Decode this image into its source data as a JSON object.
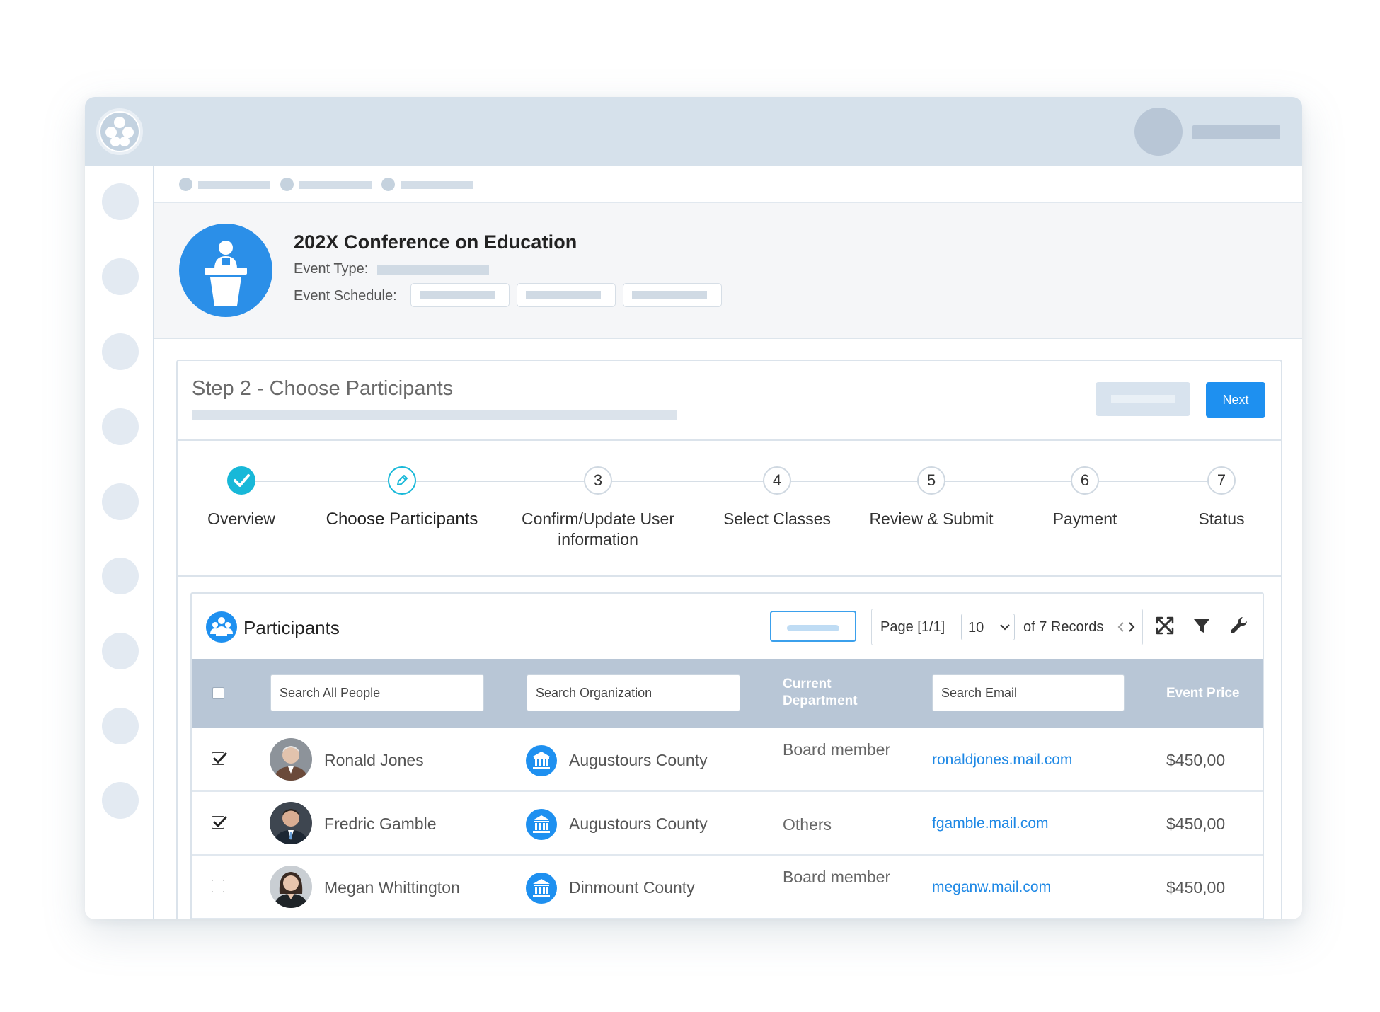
{
  "event": {
    "title": "202X Conference on Education",
    "type_label": "Event Type:",
    "schedule_label": "Event Schedule:"
  },
  "step": {
    "title": "Step 2 - Choose Participants",
    "next_label": "Next"
  },
  "stepper": [
    {
      "number": "",
      "label": "Overview",
      "state": "done"
    },
    {
      "number": "",
      "label": "Choose Participants",
      "state": "current"
    },
    {
      "number": "3",
      "label": "Confirm/Update User information",
      "state": "pending"
    },
    {
      "number": "4",
      "label": "Select Classes",
      "state": "pending"
    },
    {
      "number": "5",
      "label": "Review & Submit",
      "state": "pending"
    },
    {
      "number": "6",
      "label": "Payment",
      "state": "pending"
    },
    {
      "number": "7",
      "label": "Status",
      "state": "pending"
    }
  ],
  "panel": {
    "title": "Participants",
    "pager": {
      "page_text": "Page [1/1]",
      "page_size": "10",
      "records_text": "of 7 Records"
    }
  },
  "table": {
    "search_people_placeholder": "Search All People",
    "search_org_placeholder": "Search Organization",
    "dept_header": "Current Department",
    "search_email_placeholder": "Search Email",
    "price_header": "Event Price",
    "rows": [
      {
        "checked": true,
        "name": "Ronald Jones",
        "org": "Augustours County",
        "dept": "Board member",
        "email": "ronaldjones.mail.com",
        "price": "$450,00"
      },
      {
        "checked": true,
        "name": "Fredric Gamble",
        "org": "Augustours County",
        "dept": "Others",
        "email": "fgamble.mail.com",
        "price": "$450,00"
      },
      {
        "checked": false,
        "name": "Megan Whittington",
        "org": "Dinmount County",
        "dept": "Board member",
        "email": "meganw.mail.com",
        "price": "$450,00"
      }
    ]
  },
  "colors": {
    "accent": "#1e90f0",
    "step_done": "#18b8d8",
    "topbar": "#d6e1eb",
    "table_header": "#b8c6d6"
  },
  "icons": [
    "app-logo-icon",
    "podium-speaker-icon",
    "check-icon",
    "pencil-icon",
    "participants-group-icon",
    "expand-icon",
    "filter-icon",
    "wrench-icon",
    "institution-icon",
    "chevron-down-icon",
    "chevron-left-icon",
    "chevron-right-icon"
  ]
}
